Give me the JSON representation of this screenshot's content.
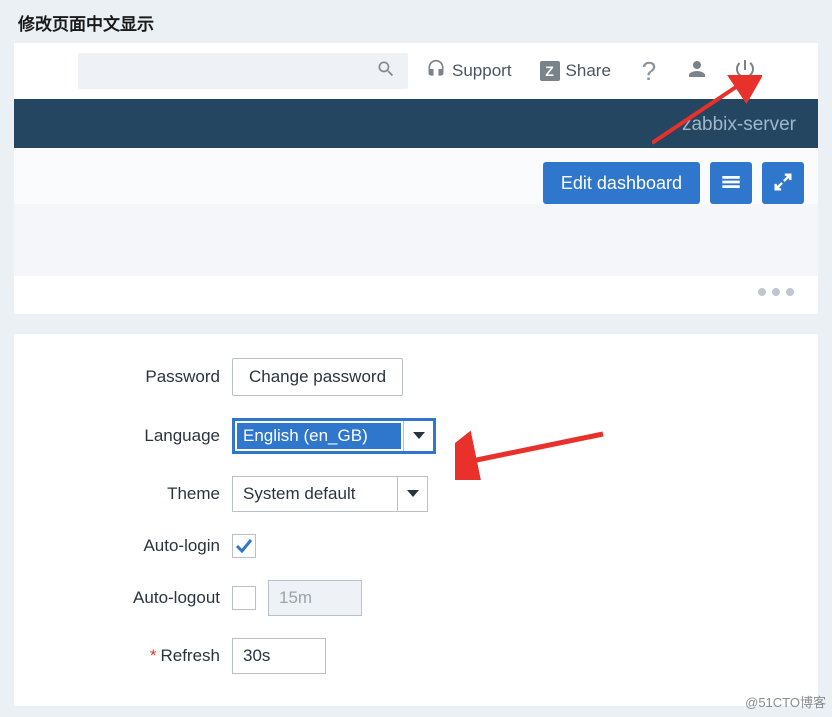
{
  "page_title": "修改页面中文显示",
  "top": {
    "support": "Support",
    "share": "Share",
    "server_label": "zabbix-server"
  },
  "toolbar": {
    "edit_dashboard": "Edit dashboard"
  },
  "form": {
    "password_label": "Password",
    "change_password_btn": "Change password",
    "language_label": "Language",
    "language_value": "English (en_GB)",
    "theme_label": "Theme",
    "theme_value": "System default",
    "autologin_label": "Auto-login",
    "autologin_checked": true,
    "autologout_label": "Auto-logout",
    "autologout_value": "15m",
    "refresh_label": "Refresh",
    "refresh_value": "30s"
  },
  "watermark": "@51CTO博客"
}
